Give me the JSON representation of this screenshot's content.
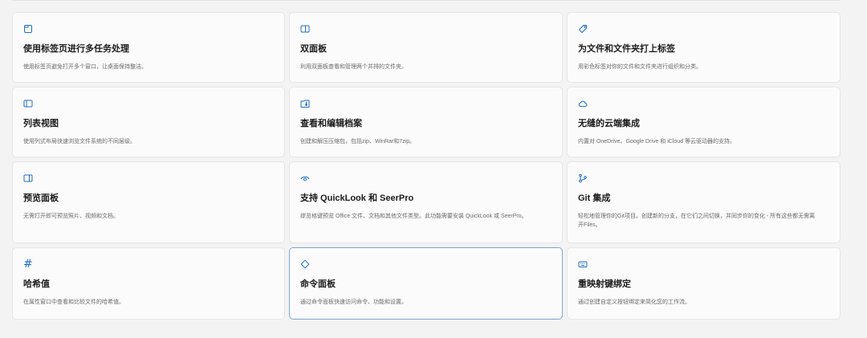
{
  "cards": [
    {
      "icon": "tab-icon",
      "title": "使用标签页进行多任务处理",
      "description": "使用标签页避免打开多个窗口，让桌面保持整洁。"
    },
    {
      "icon": "dual-pane-icon",
      "title": "双面板",
      "description": "利用双面板查看和管理两个并排的文件夹。"
    },
    {
      "icon": "tag-icon",
      "title": "为文件和文件夹打上标签",
      "description": "用彩色标签对你的文件和文件夹进行组织和分类。"
    },
    {
      "icon": "list-view-icon",
      "title": "列表视图",
      "description": "使用列式布局快速浏览文件系统的不同层级。"
    },
    {
      "icon": "archive-icon",
      "title": "查看和编辑档案",
      "description": "创建和解压压缩包，包括zip、WinRar和7zip。"
    },
    {
      "icon": "cloud-icon",
      "title": "无缝的云端集成",
      "description": "内置对 OneDrive、Google Drive 和 iCloud 等云驱动器的支持。"
    },
    {
      "icon": "preview-pane-icon",
      "title": "预览面板",
      "description": "无需打开即可预览照片、视频和文档。"
    },
    {
      "icon": "eye-icon",
      "title": "支持 QuickLook 和 SeerPro",
      "description": "综览格键预览 Office 文件、文档和其他文件类型。此功能需要安装 QuickLook 或 SeerPro。"
    },
    {
      "icon": "git-branch-icon",
      "title": "Git 集成",
      "description": "轻松地管理你的Git项目。创建新的分支，在它们之间切换，并同步你的变化 - 所有这些都无需离开Files。"
    },
    {
      "icon": "hash-icon",
      "hash_glyph": "#",
      "title": "哈希值",
      "description": "在属性窗口中查看和比较文件的哈希值。"
    },
    {
      "icon": "command-palette-icon",
      "title": "命令面板",
      "description": "通过命令面板快速访问命令、功能和设置。"
    },
    {
      "icon": "keyboard-icon",
      "title": "重映射键绑定",
      "description": "通过创建自定义按钮绑定来简化您的工作流。"
    }
  ],
  "colors": {
    "accent": "#1f6fc4",
    "background": "#f3f3f3",
    "card": "#fbfbfb",
    "selected_border": "#7aa6d6"
  }
}
